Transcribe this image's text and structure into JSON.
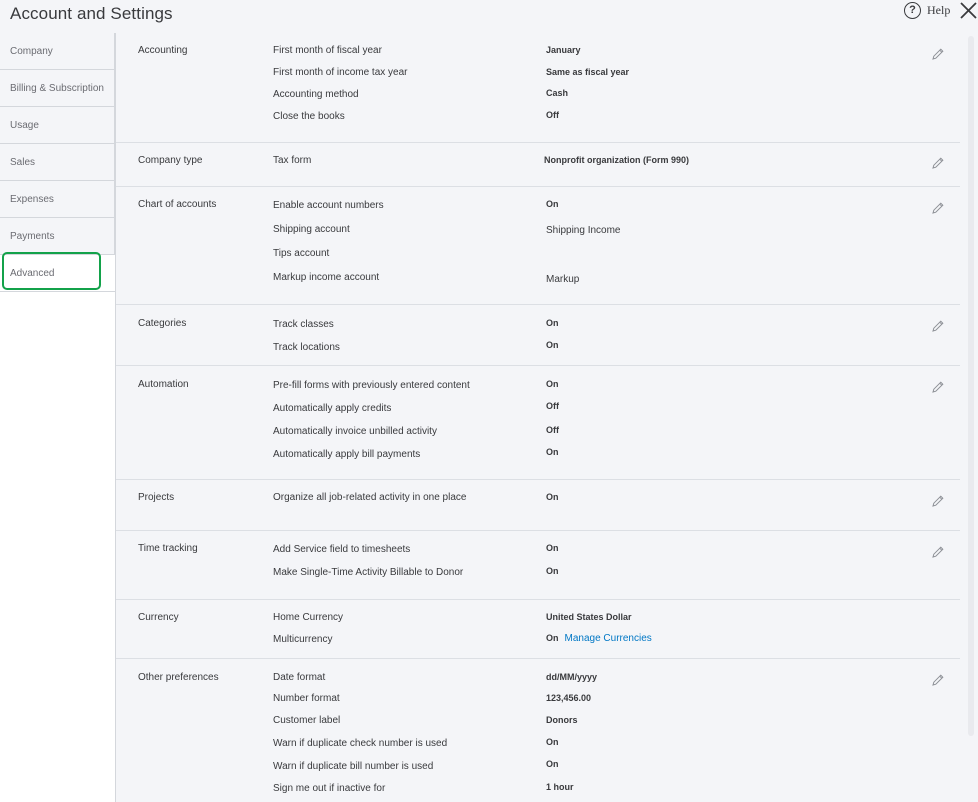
{
  "header": {
    "title": "Account and Settings",
    "help_label": "Help"
  },
  "sidebar": {
    "items": [
      {
        "label": "Company"
      },
      {
        "label": "Billing & Subscription"
      },
      {
        "label": "Usage"
      },
      {
        "label": "Sales"
      },
      {
        "label": "Expenses"
      },
      {
        "label": "Payments"
      },
      {
        "label": "Advanced"
      }
    ],
    "active": "Advanced"
  },
  "sections": {
    "accounting": {
      "title": "Accounting",
      "rows": [
        {
          "label": "First month of fiscal year",
          "value": "January"
        },
        {
          "label": "First month of income tax year",
          "value": "Same as fiscal year"
        },
        {
          "label": "Accounting method",
          "value": "Cash"
        },
        {
          "label": "Close the books",
          "value": "Off"
        }
      ]
    },
    "company_type": {
      "title": "Company type",
      "rows": [
        {
          "label": "Tax form",
          "value": "Nonprofit organization (Form 990)"
        }
      ]
    },
    "chart_of_accounts": {
      "title": "Chart of accounts",
      "rows": [
        {
          "label": "Enable account numbers",
          "value": "On"
        },
        {
          "label": "Shipping account",
          "value": "Shipping Income"
        },
        {
          "label": "Tips account",
          "value": ""
        },
        {
          "label": "Markup income account",
          "value": "Markup"
        }
      ]
    },
    "categories": {
      "title": "Categories",
      "rows": [
        {
          "label": "Track classes",
          "value": "On"
        },
        {
          "label": "Track locations",
          "value": "On"
        }
      ]
    },
    "automation": {
      "title": "Automation",
      "rows": [
        {
          "label": "Pre-fill forms with previously entered content",
          "value": "On"
        },
        {
          "label": "Automatically apply credits",
          "value": "Off"
        },
        {
          "label": "Automatically invoice unbilled activity",
          "value": "Off"
        },
        {
          "label": "Automatically apply bill payments",
          "value": "On"
        }
      ]
    },
    "projects": {
      "title": "Projects",
      "rows": [
        {
          "label": "Organize all job-related activity in one place",
          "value": "On"
        }
      ]
    },
    "time_tracking": {
      "title": "Time tracking",
      "rows": [
        {
          "label": "Add Service field to timesheets",
          "value": "On"
        },
        {
          "label": "Make Single-Time Activity Billable to Donor",
          "value": "On"
        }
      ]
    },
    "currency": {
      "title": "Currency",
      "rows": [
        {
          "label": "Home Currency",
          "value": "United States Dollar"
        },
        {
          "label": "Multicurrency",
          "value": "On",
          "link": "Manage Currencies"
        }
      ]
    },
    "other_preferences": {
      "title": "Other preferences",
      "rows": [
        {
          "label": "Date format",
          "value": "dd/MM/yyyy"
        },
        {
          "label": "Number format",
          "value": "123,456.00"
        },
        {
          "label": "Customer label",
          "value": "Donors"
        },
        {
          "label": "Warn if duplicate check number is used",
          "value": "On"
        },
        {
          "label": "Warn if duplicate bill number is used",
          "value": "On"
        },
        {
          "label": "Sign me out if inactive for",
          "value": "1 hour"
        }
      ]
    }
  },
  "icons": {
    "help": "question-circle-icon",
    "close": "close-icon",
    "edit": "pencil-icon"
  },
  "colors": {
    "background": "#f4f5f8",
    "text": "#393a3d",
    "link": "#0077c5",
    "highlight": "#13a24a",
    "divider": "#dcdfe4"
  }
}
